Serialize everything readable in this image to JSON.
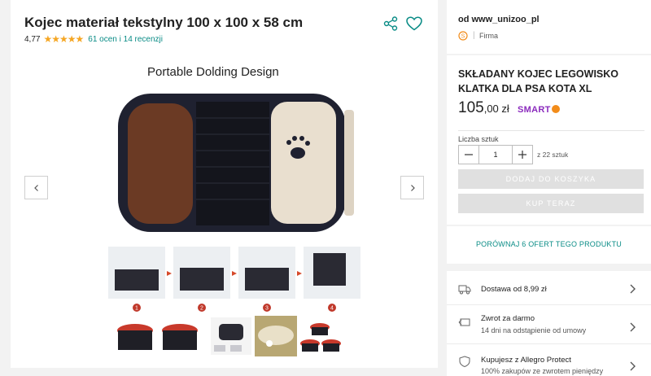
{
  "product": {
    "title": "Kojec materiał tekstylny 100 x 100 x 58 cm",
    "rating": "4,77",
    "stars": "★★★★★",
    "reviews": "61 ocen i 14 recenzji",
    "image_heading": "Portable Dolding Design",
    "step_numbers": [
      "1",
      "2",
      "3",
      "4"
    ]
  },
  "seller": {
    "name": "od www_unizoo_pl",
    "separator": "|",
    "type": "Firma"
  },
  "offer": {
    "name": "SKŁADANY KOJEC LEGOWISKO KLATKA DLA PSA KOTA XL",
    "price_main": "105",
    "price_cents": ",00 zł",
    "smart": "SMART",
    "qty_label": "Liczba sztuk",
    "qty_value": "1",
    "stock": "z 22 sztuk",
    "add_to_cart": "DODAJ DO KOSZYKA",
    "buy_now": "KUP TERAZ",
    "compare": "PORÓWNAJ 6 OFERT TEGO PRODUKTU"
  },
  "info": {
    "delivery": "Dostawa od 8,99 zł",
    "returns_title": "Zwrot za darmo",
    "returns_sub": "14 dni na odstąpienie od umowy",
    "protect_title": "Kupujesz z Allegro Protect",
    "protect_sub": "100% zakupów ze zwrotem pieniędzy"
  },
  "colors": {
    "accent": "#0a8c86",
    "stars": "#f5a623",
    "smart": "#8b2bbd",
    "disabled": "#e0e0e0"
  },
  "icons": [
    "share-icon",
    "heart-icon",
    "chevron-left-icon",
    "chevron-right-icon",
    "truck-icon",
    "return-icon",
    "shield-hand-icon"
  ]
}
